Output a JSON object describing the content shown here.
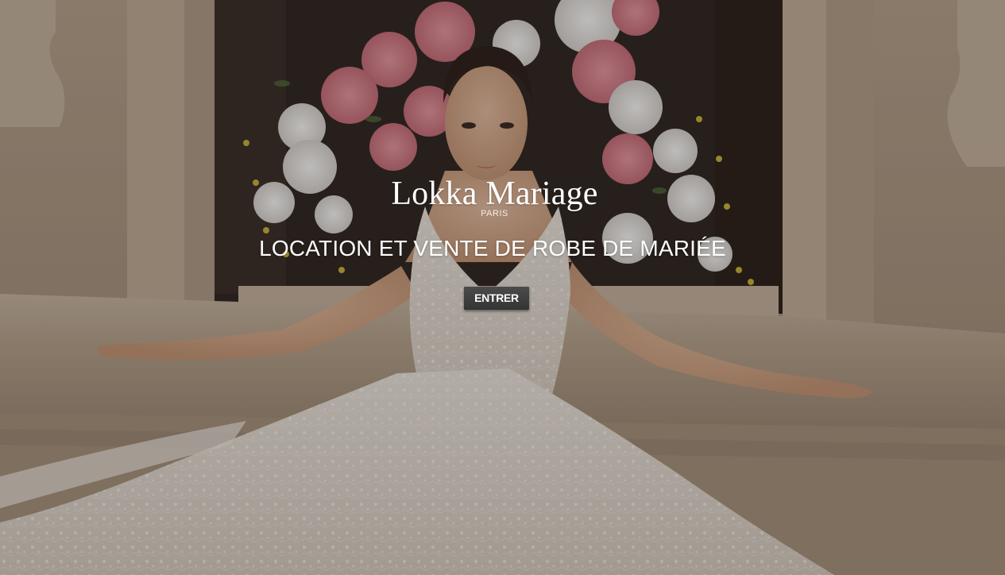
{
  "page": {
    "brand_name": "Lokka Mariage",
    "brand_subtitle": "PARIS",
    "tagline": "LOCATION ET VENTE DE ROBE DE MARIÉE",
    "enter_label": "ENTRER"
  },
  "hero": {
    "image": "background-photo",
    "description_tag": "bride-in-lace-dress"
  },
  "colors": {
    "text": "#ffffff",
    "button_bg": "#3f3f3f",
    "overlay": "#140e0a"
  }
}
